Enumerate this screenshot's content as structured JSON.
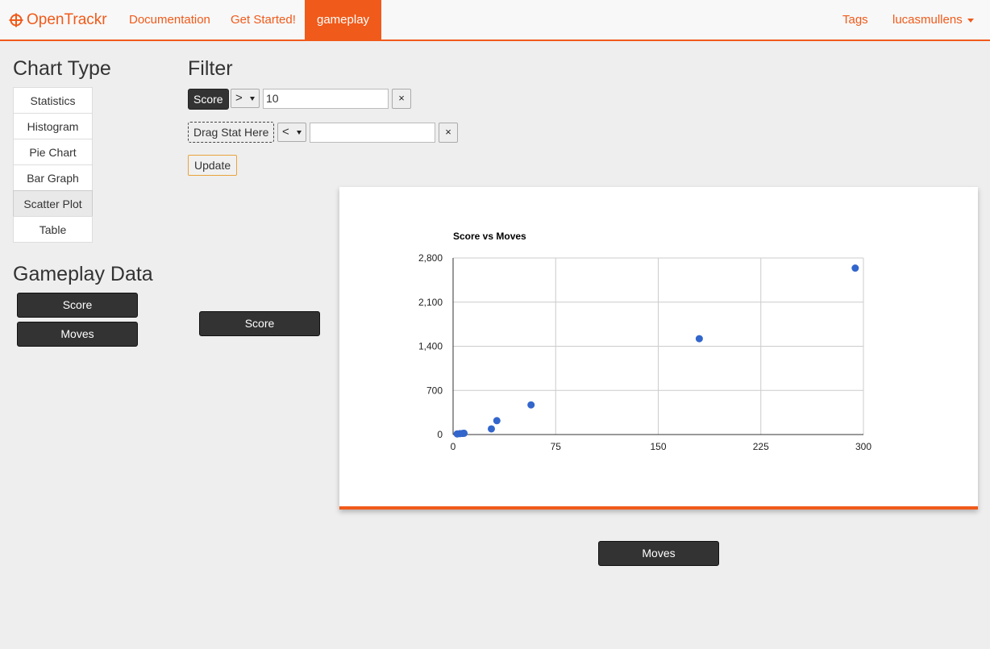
{
  "navbar": {
    "brand": "OpenTrackr",
    "links": [
      "Documentation",
      "Get Started!",
      "gameplay"
    ],
    "right_links": {
      "tags": "Tags",
      "user": "lucasmullens"
    },
    "accent": "#f05a1a"
  },
  "sidebar": {
    "chart_type_heading": "Chart Type",
    "chart_types": [
      "Statistics",
      "Histogram",
      "Pie Chart",
      "Bar Graph",
      "Scatter Plot",
      "Table"
    ],
    "selected_chart_type": "Scatter Plot",
    "gameplay_heading": "Gameplay Data",
    "gameplay_stats": [
      "Score",
      "Moves"
    ]
  },
  "filter": {
    "heading": "Filter",
    "rows": [
      {
        "stat": "Score",
        "operator": ">",
        "value": "10",
        "remove": "×"
      },
      {
        "stat": "Drag Stat Here",
        "operator": "<",
        "value": "",
        "remove": "×"
      }
    ],
    "update_label": "Update"
  },
  "axes_controls": {
    "y_stat": "Score",
    "x_stat": "Moves"
  },
  "chart_data": {
    "type": "scatter",
    "title": "Score vs Moves",
    "xlabel": "",
    "ylabel": "",
    "xlim": [
      0,
      300
    ],
    "ylim": [
      0,
      2800
    ],
    "x_ticks": [
      "0",
      "75",
      "150",
      "225",
      "300"
    ],
    "y_ticks": [
      "0",
      "700",
      "1,400",
      "2,100",
      "2,800"
    ],
    "grid": true,
    "point_color": "#3366cc",
    "points": [
      {
        "x": 3,
        "y": 10
      },
      {
        "x": 5,
        "y": 15
      },
      {
        "x": 7,
        "y": 18
      },
      {
        "x": 8,
        "y": 20
      },
      {
        "x": 28,
        "y": 90
      },
      {
        "x": 32,
        "y": 220
      },
      {
        "x": 57,
        "y": 470
      },
      {
        "x": 180,
        "y": 1520
      },
      {
        "x": 294,
        "y": 2640
      }
    ]
  }
}
